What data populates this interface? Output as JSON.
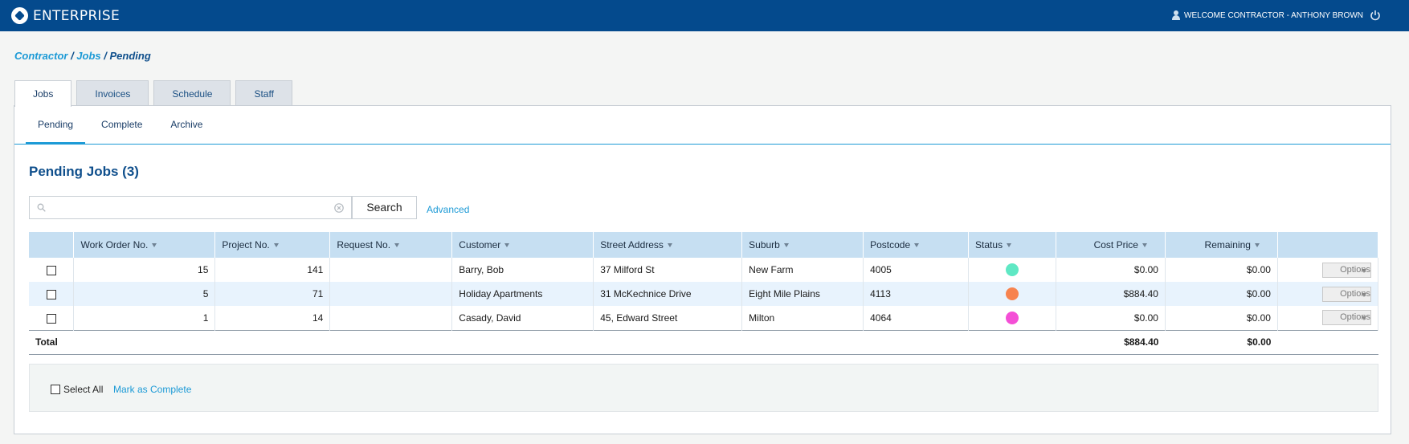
{
  "header": {
    "logo_text": "ENTERPRISE",
    "welcome": "WELCOME CONTRACTOR - ANTHONY BROWN"
  },
  "breadcrumb": {
    "items": [
      "Contractor",
      "Jobs",
      "Pending"
    ],
    "separator": " / "
  },
  "main_tabs": [
    "Jobs",
    "Invoices",
    "Schedule",
    "Staff"
  ],
  "active_main_tab": "Jobs",
  "sub_tabs": [
    "Pending",
    "Complete",
    "Archive"
  ],
  "active_sub_tab": "Pending",
  "page_title": "Pending Jobs (3)",
  "search": {
    "value": "",
    "placeholder": "",
    "button_label": "Search",
    "advanced_label": "Advanced"
  },
  "table": {
    "columns": [
      "Work Order No.",
      "Project No.",
      "Request No.",
      "Customer",
      "Street Address",
      "Suburb",
      "Postcode",
      "Status",
      "Cost Price",
      "Remaining"
    ],
    "rows": [
      {
        "work_order": "15",
        "project": "141",
        "request": "",
        "customer": "Barry, Bob",
        "address": "37 Milford St",
        "suburb": "New Farm",
        "postcode": "4005",
        "status_color": "#5fe8c4",
        "cost": "$0.00",
        "remaining": "$0.00",
        "options": "Options"
      },
      {
        "work_order": "5",
        "project": "71",
        "request": "",
        "customer": "Holiday Apartments",
        "address": "31 McKechnice Drive",
        "suburb": "Eight Mile Plains",
        "postcode": "4113",
        "status_color": "#f7834f",
        "cost": "$884.40",
        "remaining": "$0.00",
        "options": "Options"
      },
      {
        "work_order": "1",
        "project": "14",
        "request": "",
        "customer": "Casady, David",
        "address": "45, Edward Street",
        "suburb": "Milton",
        "postcode": "4064",
        "status_color": "#f44fd6",
        "cost": "$0.00",
        "remaining": "$0.00",
        "options": "Options"
      }
    ],
    "total": {
      "label": "Total",
      "cost": "$884.40",
      "remaining": "$0.00"
    }
  },
  "footer": {
    "select_all": "Select All",
    "mark_complete": "Mark as Complete"
  },
  "colors": {
    "topbar": "#044a8d",
    "accent": "#1c9ad6",
    "header_row": "#c6dff2"
  },
  "icons": [
    "logo-icon",
    "user-icon",
    "power-icon",
    "search-icon",
    "clear-icon",
    "sort-arrow-icon",
    "chevron-down-icon"
  ]
}
